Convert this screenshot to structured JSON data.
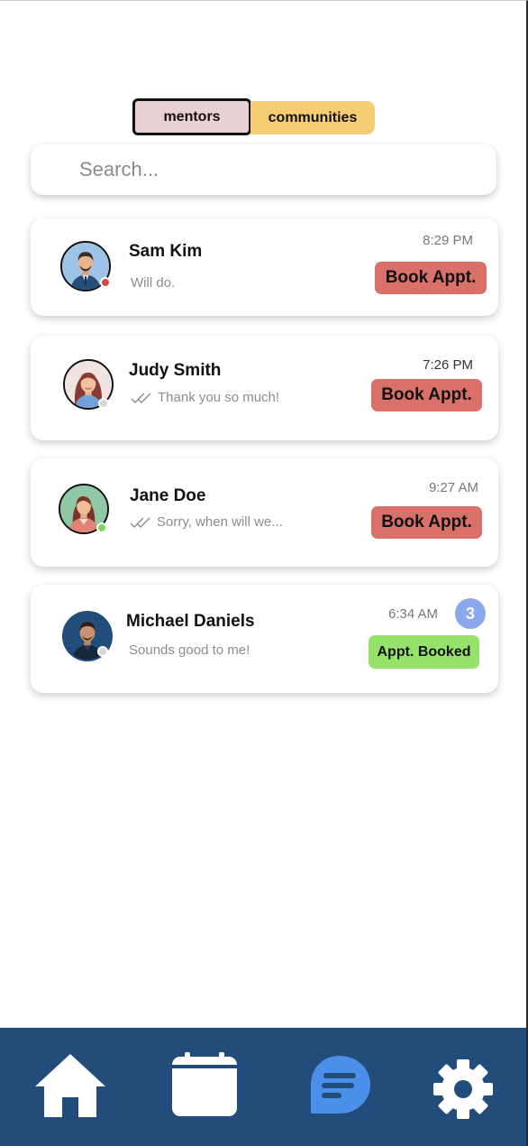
{
  "toggle": {
    "mentors_label": "mentors",
    "communities_label": "communities"
  },
  "search": {
    "placeholder": "Search..."
  },
  "conversations": [
    {
      "name": "Sam Kim",
      "preview": "Will do.",
      "time": "8:29 PM",
      "action": "Book Appt.",
      "status": "red",
      "read_receipt": false,
      "avatar_icon": "man-avatar-icon"
    },
    {
      "name": "Judy Smith",
      "preview": "Thank you so much!",
      "time": "7:26 PM",
      "action": "Book Appt.",
      "status": "gray",
      "read_receipt": true,
      "avatar_icon": "woman-avatar-icon"
    },
    {
      "name": "Jane Doe",
      "preview": "Sorry, when will we...",
      "time": "9:27 AM",
      "action": "Book Appt.",
      "status": "green",
      "read_receipt": true,
      "avatar_icon": "woman-avatar-icon"
    },
    {
      "name": "Michael Daniels",
      "preview": "Sounds good to me!",
      "time": "6:34 AM",
      "action": "Appt. Booked",
      "status": "gray",
      "read_receipt": false,
      "unread": "3",
      "avatar_icon": "man-avatar-icon"
    }
  ],
  "colors": {
    "book_button": "#d9716a",
    "booked_button": "#95e36b",
    "nav_background": "#224c7a",
    "active_nav": "#4a8fe9",
    "status_red": "#d64848",
    "status_green": "#7ed858",
    "status_gray": "#d8d8d8",
    "unread_badge": "#8aa8ec"
  },
  "bottom_nav": {
    "items": [
      {
        "icon": "home-icon",
        "active": false
      },
      {
        "icon": "calendar-icon",
        "active": false
      },
      {
        "icon": "chat-icon",
        "active": true
      },
      {
        "icon": "gear-icon",
        "active": false
      }
    ]
  }
}
